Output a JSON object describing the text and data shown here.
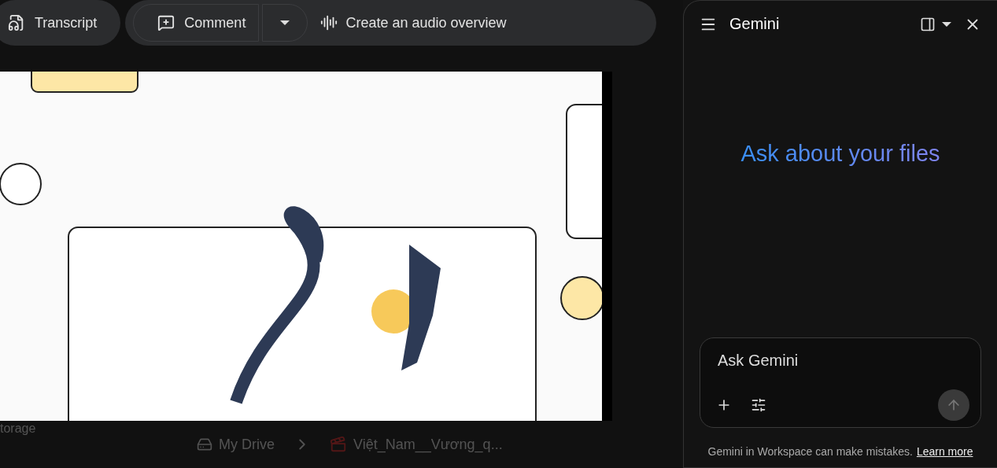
{
  "toolbar": {
    "transcript": "Transcript",
    "comment": "Comment",
    "audio_overview": "Create an audio overview"
  },
  "background": {
    "storage_fragment": "torage",
    "breadcrumb": [
      "My Drive",
      "Việt_Nam__Vương_q..."
    ]
  },
  "gemini": {
    "title": "Gemini",
    "heading": "Ask about your files",
    "input": {
      "placeholder": "Ask Gemini"
    },
    "disclaimer": "Gemini in Workspace can make mistakes.",
    "link": "Learn more"
  }
}
